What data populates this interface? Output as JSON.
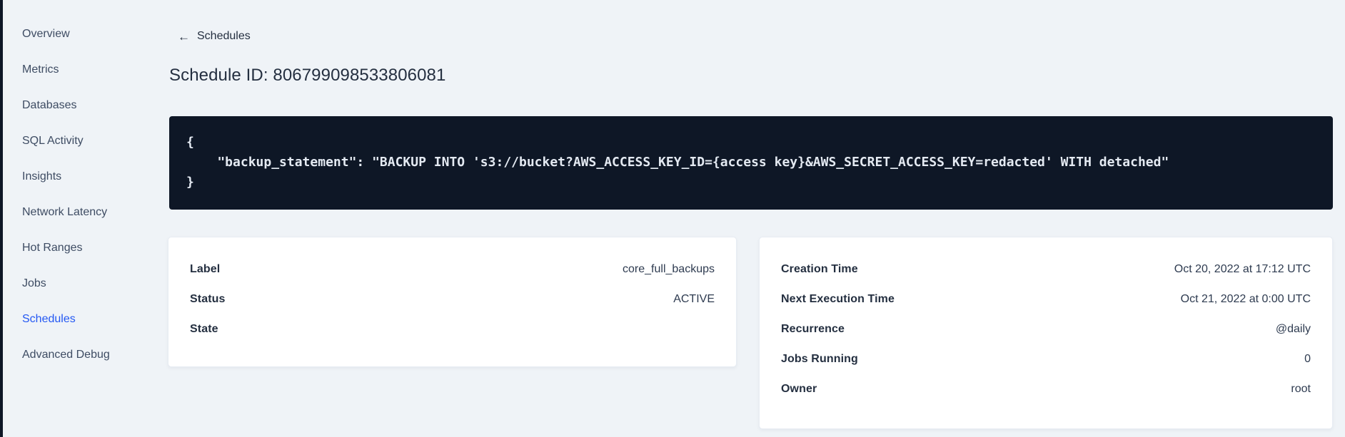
{
  "colors": {
    "page_bg": "#EFF3F7",
    "code_bg": "#0E1726",
    "accent_blue": "#2458F3",
    "text_dark": "#242F40"
  },
  "sidebar": {
    "items": [
      {
        "label": "Overview",
        "active": false
      },
      {
        "label": "Metrics",
        "active": false
      },
      {
        "label": "Databases",
        "active": false
      },
      {
        "label": "SQL Activity",
        "active": false
      },
      {
        "label": "Insights",
        "active": false
      },
      {
        "label": "Network Latency",
        "active": false
      },
      {
        "label": "Hot Ranges",
        "active": false
      },
      {
        "label": "Jobs",
        "active": false
      },
      {
        "label": "Schedules",
        "active": true
      },
      {
        "label": "Advanced Debug",
        "active": false
      }
    ]
  },
  "header": {
    "back_icon": "←",
    "back_label": "Schedules",
    "title": "Schedule ID: 806799098533806081"
  },
  "code_block": {
    "lines": [
      "{",
      "    \"backup_statement\": \"BACKUP INTO 's3://bucket?AWS_ACCESS_KEY_ID={access key}&AWS_SECRET_ACCESS_KEY=redacted' WITH detached\"",
      "}"
    ]
  },
  "cards": {
    "left": {
      "rows": [
        {
          "label": "Label",
          "value": "core_full_backups"
        },
        {
          "label": "Status",
          "value": "ACTIVE"
        },
        {
          "label": "State",
          "value": ""
        }
      ]
    },
    "right": {
      "rows": [
        {
          "label": "Creation Time",
          "value": "Oct 20, 2022 at 17:12 UTC"
        },
        {
          "label": "Next Execution Time",
          "value": "Oct 21, 2022 at 0:00 UTC"
        },
        {
          "label": "Recurrence",
          "value": "@daily"
        },
        {
          "label": "Jobs Running",
          "value": "0"
        },
        {
          "label": "Owner",
          "value": "root"
        }
      ]
    }
  }
}
